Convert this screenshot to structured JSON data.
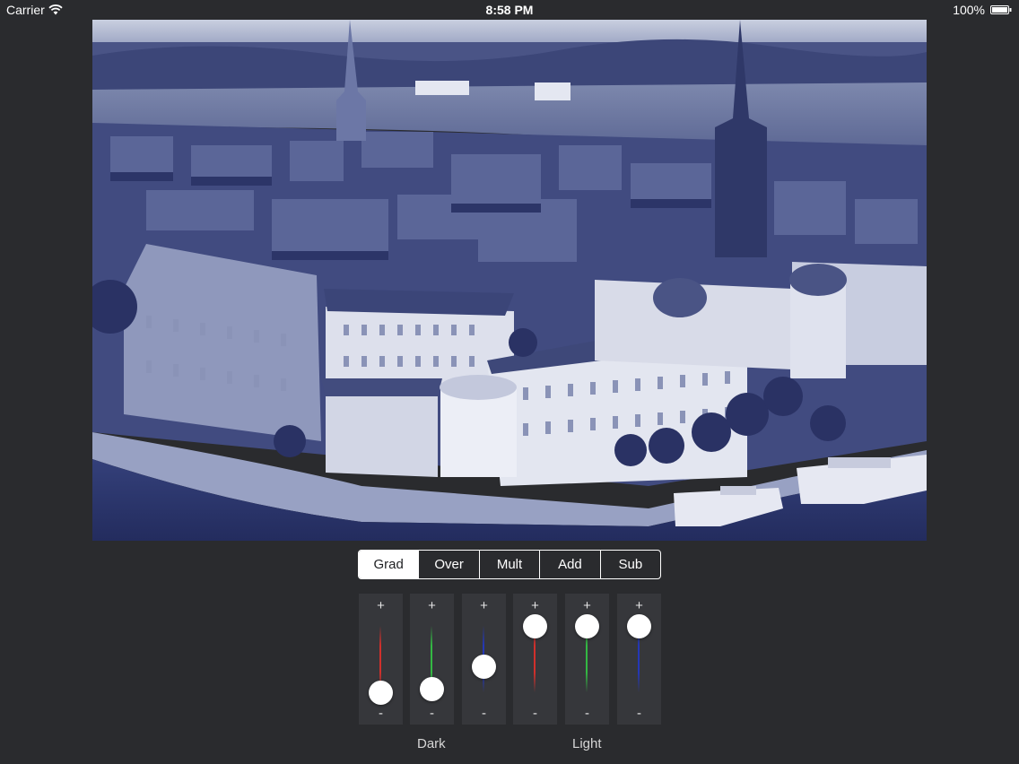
{
  "status_bar": {
    "carrier": "Carrier",
    "time": "8:58 PM",
    "battery_percent": "100%",
    "icons": [
      "wifi-icon",
      "battery-icon"
    ]
  },
  "photo": {
    "description_icon": "photo-preview",
    "tint_color": "#3a4a8a"
  },
  "blend_modes": {
    "selected": "Grad",
    "options": [
      "Grad",
      "Over",
      "Mult",
      "Add",
      "Sub"
    ]
  },
  "sliders": {
    "plus_label": "+",
    "minus_label": "-",
    "items": [
      {
        "group": "Dark",
        "channel": "red",
        "color": "#d0302c",
        "level": 0.0
      },
      {
        "group": "Dark",
        "channel": "green",
        "color": "#33b843",
        "level": 0.05
      },
      {
        "group": "Dark",
        "channel": "blue",
        "color": "#2437b6",
        "level": 0.38
      },
      {
        "group": "Light",
        "channel": "red",
        "color": "#d0302c",
        "level": 1.0
      },
      {
        "group": "Light",
        "channel": "green",
        "color": "#33b843",
        "level": 1.0
      },
      {
        "group": "Light",
        "channel": "blue",
        "color": "#2437b6",
        "level": 1.0
      }
    ]
  },
  "captions": {
    "dark": "Dark",
    "light": "Light"
  },
  "colors": {
    "background": "#2a2b2e",
    "panel": "#36373b",
    "accent": "#ffffff"
  }
}
